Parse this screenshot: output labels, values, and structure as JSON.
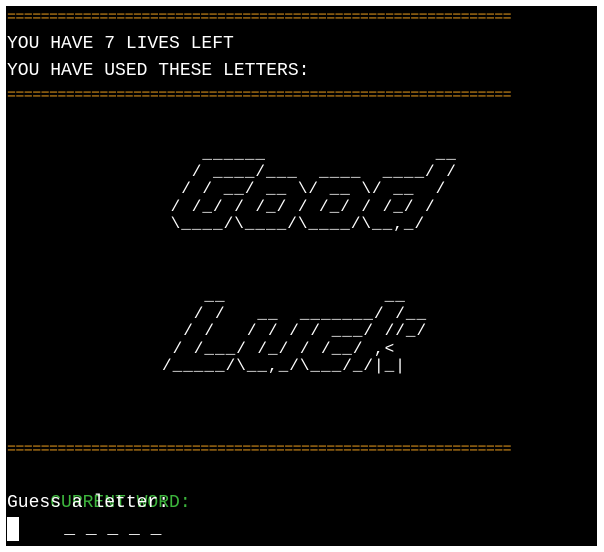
{
  "terminal": {
    "rule": "============================================================",
    "lives_line": "YOU HAVE 7 LIVES LEFT",
    "used_line": "YOU HAVE USED THESE LETTERS:",
    "banner_good": "    ______                __\n   / ____/___  ____  ____/ /\n  / / __/ __ \\/ __ \\/ __  /\n / /_/ / /_/ / /_/ / /_/ /\n \\____/\\____/\\____/\\__,_/",
    "banner_luck": "    __               __\n   / /   __  _______/ /__\n  / /   / / / / ___/ //_/\n / /___/ /_/ / /__/ ,<\n/_____/\\__,_/\\___/_/|_|",
    "current_label": "CURRENT WORD:",
    "current_blanks": "_ _ _ _ _",
    "prompt": "Guess a letter:"
  },
  "colors": {
    "background": "#000000",
    "rule": "#d08a1a",
    "current_label": "#3cb43c",
    "text": "#ffffff"
  }
}
